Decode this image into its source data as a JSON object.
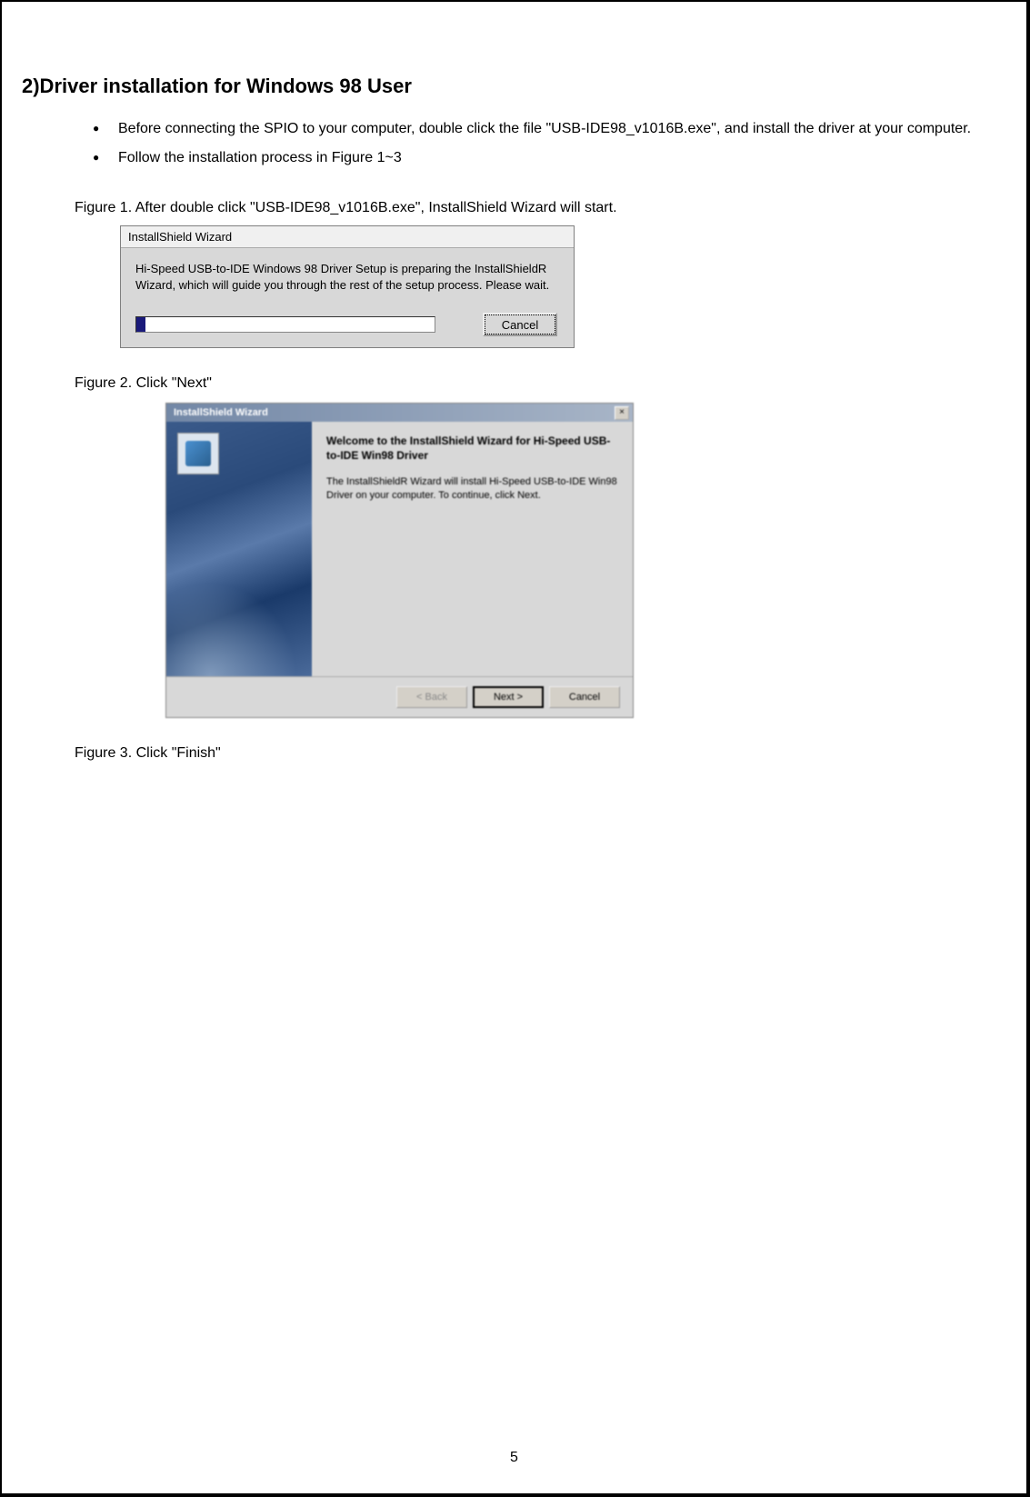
{
  "section_title": "2)Driver installation for Windows 98 User",
  "bullets": {
    "item1": "Before connecting the SPIO to your computer, double click the file \"USB-IDE98_v1016B.exe\", and install the driver at your computer.",
    "item2": "Follow the installation process in Figure 1~3"
  },
  "figure1": {
    "caption": "Figure 1. After double click \"USB-IDE98_v1016B.exe\", InstallShield Wizard will start.",
    "dialog_title": "InstallShield Wizard",
    "body_text": "Hi-Speed USB-to-IDE Windows 98 Driver Setup is preparing the InstallShieldR Wizard, which will guide you through the rest of the setup process. Please wait.",
    "cancel_label": "Cancel"
  },
  "figure2": {
    "caption": "Figure 2. Click \"Next\"",
    "dialog_title": "InstallShield Wizard",
    "heading": "Welcome to the InstallShield Wizard for Hi-Speed USB-to-IDE Win98 Driver",
    "subtext": "The InstallShieldR Wizard will install Hi-Speed USB-to-IDE Win98 Driver on your computer.  To continue, click Next.",
    "back_label": "< Back",
    "next_label": "Next >",
    "cancel_label": "Cancel",
    "close_label": "×"
  },
  "figure3": {
    "caption": "Figure 3. Click \"Finish\""
  },
  "page_number": "5"
}
